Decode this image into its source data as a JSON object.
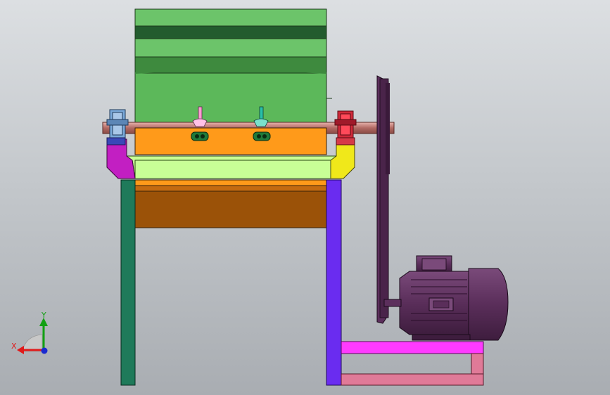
{
  "viewport": {
    "triad": {
      "x_label": "X",
      "y_label": "Y"
    }
  },
  "colors": {
    "bg_top": "#dcdfe2",
    "bg_bottom": "#a9adb2",
    "hopper_green": "#6cc46a",
    "hopper_band": "#235c2e",
    "drum_green": "#5cb85a",
    "orange_band": "#ff9a1a",
    "light_green_frame": "#c8ff96",
    "brown_hopper": "#9b5208",
    "leg_left": "#1f7a5a",
    "leg_right": "#6a2cf0",
    "bracket_magenta": "#c21fc2",
    "bracket_yellow": "#f0e81a",
    "shaft": "#c88a84",
    "bearing_left": "#7aa8d8",
    "bearing_right": "#d02a3a",
    "pulley": "#5c2f5c",
    "motor": "#5a2e5a",
    "base_magenta": "#ff3aff",
    "base_pink": "#e07a98"
  },
  "icons": [
    "axis-triad-icon",
    "wing-nut-icon"
  ]
}
